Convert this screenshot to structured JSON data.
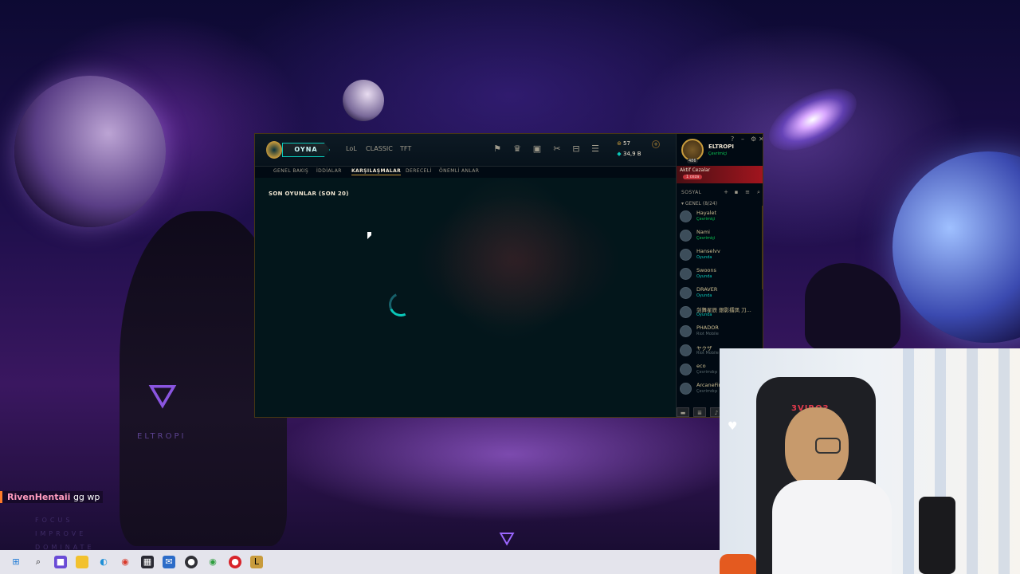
{
  "client": {
    "play_label": "OYNA",
    "top_nav": [
      "LoL",
      "CLASSIC",
      "TFT"
    ],
    "icons": [
      "map-icon",
      "trophy-icon",
      "chest-icon",
      "crafting-icon",
      "collection-icon",
      "store-icon"
    ],
    "currency": {
      "rp": "57",
      "blue_essence": "34,9 B"
    },
    "sub_tabs": [
      {
        "label": "GENEL BAKIŞ",
        "active": false
      },
      {
        "label": "İDDİALAR",
        "active": false
      },
      {
        "label": "KARŞILAŞMALAR",
        "active": true
      },
      {
        "label": "DERECELİ",
        "active": false
      },
      {
        "label": "ÖNEMLİ ANLAR",
        "active": false
      }
    ],
    "recent_games_title": "SON OYUNLAR (SON 20)"
  },
  "social": {
    "profile_name": "ELTROPI",
    "profile_status": "Çevrimiçi",
    "level": "486",
    "penalty_title": "Aktif Cezalar",
    "penalty_chip": "1 ceza",
    "section_label": "SOSYAL",
    "group_label": "GENEL (8/24)",
    "friends": [
      {
        "name": "Hayalet",
        "status": "Çevrimiçi",
        "state": "online"
      },
      {
        "name": "Nami",
        "status": "Çevrimiçi",
        "state": "online"
      },
      {
        "name": "Hanselvv",
        "status": "Oyunda",
        "state": "ingame"
      },
      {
        "name": "Swoons",
        "status": "Oyunda",
        "state": "ingame"
      },
      {
        "name": "DRAVER",
        "status": "Oyunda",
        "state": "ingame"
      },
      {
        "name": "剑舞星辰 銀影擂凤 刀...",
        "status": "Oyunda",
        "state": "ingame"
      },
      {
        "name": "PHADOR",
        "status": "Riot Mobile",
        "state": "mobile"
      },
      {
        "name": "ヤクザ",
        "status": "Riot Mobile",
        "state": "mobile"
      },
      {
        "name": "eco",
        "status": "Çevrimdışı",
        "state": "offline"
      },
      {
        "name": "ArcaneFire",
        "status": "Çevrimdışı",
        "state": "offline"
      }
    ]
  },
  "chat": {
    "user": "RivenHentaii",
    "message": "gg wp"
  },
  "wallpaper": {
    "brand": "ELTROPI",
    "footer_words": [
      "FOCUS",
      "IMPROVE",
      "DOMINATE"
    ]
  },
  "webcam": {
    "chair_brand": "3VIROƧ"
  },
  "taskbar": {
    "icons": [
      "windows-start-icon",
      "search-icon",
      "file-explorer-icon",
      "folder-icon",
      "edge-icon",
      "chrome-icon",
      "calculator-icon",
      "mail-icon",
      "obs-icon",
      "chrome-alt-icon",
      "record-icon",
      "league-client-icon"
    ]
  },
  "colors": {
    "gold": "#c89b3c",
    "teal": "#0ac8b9",
    "penalty_red": "#a3151e",
    "online_green": "#0acb54"
  }
}
